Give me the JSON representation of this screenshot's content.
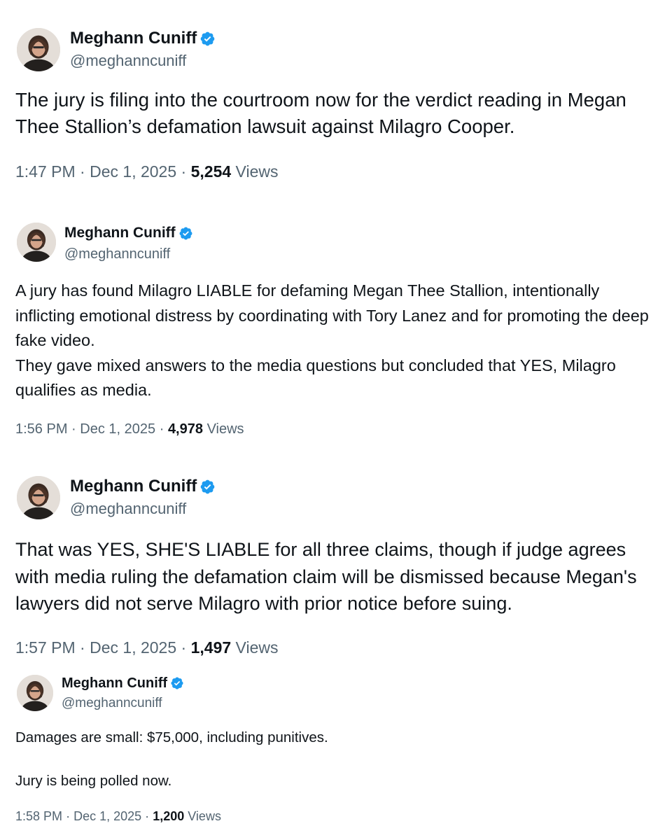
{
  "colors": {
    "text": "#0f1419",
    "secondary": "#536471",
    "verified": "#1d9bf0",
    "background": "#ffffff"
  },
  "tweets": [
    {
      "author": {
        "name": "Meghann Cuniff",
        "handle": "@meghanncuniff",
        "verified_icon": "verified-badge-icon",
        "avatar_icon": "avatar"
      },
      "text": [
        "The jury is filing into the courtroom now for the verdict reading in Megan Thee Stallion’s defamation lawsuit against Milagro Cooper."
      ],
      "time": "1:47 PM",
      "date": "Dec 1, 2025",
      "views_count": "5,254",
      "views_label": "Views"
    },
    {
      "author": {
        "name": "Meghann Cuniff",
        "handle": "@meghanncuniff",
        "verified_icon": "verified-badge-icon",
        "avatar_icon": "avatar"
      },
      "text": [
        "A jury has found Milagro LIABLE for defaming Megan Thee Stallion, intentionally inflicting emotional distress by coordinating with Tory Lanez and for promoting the deep fake video.",
        "They gave mixed answers to the media questions but concluded that YES, Milagro qualifies as media."
      ],
      "time": "1:56 PM",
      "date": "Dec 1, 2025",
      "views_count": "4,978",
      "views_label": "Views"
    },
    {
      "author": {
        "name": "Meghann Cuniff",
        "handle": "@meghanncuniff",
        "verified_icon": "verified-badge-icon",
        "avatar_icon": "avatar"
      },
      "text": [
        "That was YES, SHE'S LIABLE for all three claims, though if judge agrees with media ruling the defamation claim will be dismissed because Megan's lawyers did not serve Milagro with prior notice before suing."
      ],
      "time": "1:57 PM",
      "date": "Dec 1, 2025",
      "views_count": "1,497",
      "views_label": "Views"
    },
    {
      "author": {
        "name": "Meghann Cuniff",
        "handle": "@meghanncuniff",
        "verified_icon": "verified-badge-icon",
        "avatar_icon": "avatar"
      },
      "text": [
        "Damages are small: $75,000, including punitives.",
        "Jury is being polled now."
      ],
      "time": "1:58 PM",
      "date": "Dec 1, 2025",
      "views_count": "1,200",
      "views_label": "Views"
    }
  ],
  "separator": "·"
}
